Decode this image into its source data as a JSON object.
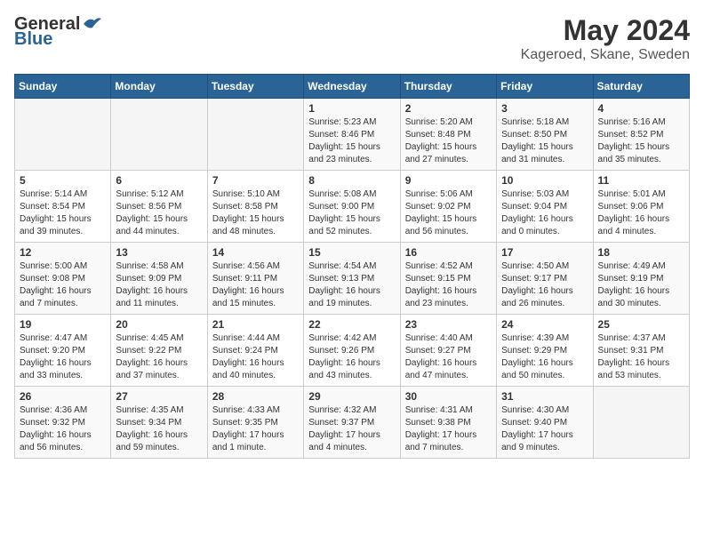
{
  "header": {
    "logo_general": "General",
    "logo_blue": "Blue",
    "month_year": "May 2024",
    "location": "Kageroed, Skane, Sweden"
  },
  "days_of_week": [
    "Sunday",
    "Monday",
    "Tuesday",
    "Wednesday",
    "Thursday",
    "Friday",
    "Saturday"
  ],
  "weeks": [
    [
      {
        "day": "",
        "info": ""
      },
      {
        "day": "",
        "info": ""
      },
      {
        "day": "",
        "info": ""
      },
      {
        "day": "1",
        "info": "Sunrise: 5:23 AM\nSunset: 8:46 PM\nDaylight: 15 hours and 23 minutes."
      },
      {
        "day": "2",
        "info": "Sunrise: 5:20 AM\nSunset: 8:48 PM\nDaylight: 15 hours and 27 minutes."
      },
      {
        "day": "3",
        "info": "Sunrise: 5:18 AM\nSunset: 8:50 PM\nDaylight: 15 hours and 31 minutes."
      },
      {
        "day": "4",
        "info": "Sunrise: 5:16 AM\nSunset: 8:52 PM\nDaylight: 15 hours and 35 minutes."
      }
    ],
    [
      {
        "day": "5",
        "info": "Sunrise: 5:14 AM\nSunset: 8:54 PM\nDaylight: 15 hours and 39 minutes."
      },
      {
        "day": "6",
        "info": "Sunrise: 5:12 AM\nSunset: 8:56 PM\nDaylight: 15 hours and 44 minutes."
      },
      {
        "day": "7",
        "info": "Sunrise: 5:10 AM\nSunset: 8:58 PM\nDaylight: 15 hours and 48 minutes."
      },
      {
        "day": "8",
        "info": "Sunrise: 5:08 AM\nSunset: 9:00 PM\nDaylight: 15 hours and 52 minutes."
      },
      {
        "day": "9",
        "info": "Sunrise: 5:06 AM\nSunset: 9:02 PM\nDaylight: 15 hours and 56 minutes."
      },
      {
        "day": "10",
        "info": "Sunrise: 5:03 AM\nSunset: 9:04 PM\nDaylight: 16 hours and 0 minutes."
      },
      {
        "day": "11",
        "info": "Sunrise: 5:01 AM\nSunset: 9:06 PM\nDaylight: 16 hours and 4 minutes."
      }
    ],
    [
      {
        "day": "12",
        "info": "Sunrise: 5:00 AM\nSunset: 9:08 PM\nDaylight: 16 hours and 7 minutes."
      },
      {
        "day": "13",
        "info": "Sunrise: 4:58 AM\nSunset: 9:09 PM\nDaylight: 16 hours and 11 minutes."
      },
      {
        "day": "14",
        "info": "Sunrise: 4:56 AM\nSunset: 9:11 PM\nDaylight: 16 hours and 15 minutes."
      },
      {
        "day": "15",
        "info": "Sunrise: 4:54 AM\nSunset: 9:13 PM\nDaylight: 16 hours and 19 minutes."
      },
      {
        "day": "16",
        "info": "Sunrise: 4:52 AM\nSunset: 9:15 PM\nDaylight: 16 hours and 23 minutes."
      },
      {
        "day": "17",
        "info": "Sunrise: 4:50 AM\nSunset: 9:17 PM\nDaylight: 16 hours and 26 minutes."
      },
      {
        "day": "18",
        "info": "Sunrise: 4:49 AM\nSunset: 9:19 PM\nDaylight: 16 hours and 30 minutes."
      }
    ],
    [
      {
        "day": "19",
        "info": "Sunrise: 4:47 AM\nSunset: 9:20 PM\nDaylight: 16 hours and 33 minutes."
      },
      {
        "day": "20",
        "info": "Sunrise: 4:45 AM\nSunset: 9:22 PM\nDaylight: 16 hours and 37 minutes."
      },
      {
        "day": "21",
        "info": "Sunrise: 4:44 AM\nSunset: 9:24 PM\nDaylight: 16 hours and 40 minutes."
      },
      {
        "day": "22",
        "info": "Sunrise: 4:42 AM\nSunset: 9:26 PM\nDaylight: 16 hours and 43 minutes."
      },
      {
        "day": "23",
        "info": "Sunrise: 4:40 AM\nSunset: 9:27 PM\nDaylight: 16 hours and 47 minutes."
      },
      {
        "day": "24",
        "info": "Sunrise: 4:39 AM\nSunset: 9:29 PM\nDaylight: 16 hours and 50 minutes."
      },
      {
        "day": "25",
        "info": "Sunrise: 4:37 AM\nSunset: 9:31 PM\nDaylight: 16 hours and 53 minutes."
      }
    ],
    [
      {
        "day": "26",
        "info": "Sunrise: 4:36 AM\nSunset: 9:32 PM\nDaylight: 16 hours and 56 minutes."
      },
      {
        "day": "27",
        "info": "Sunrise: 4:35 AM\nSunset: 9:34 PM\nDaylight: 16 hours and 59 minutes."
      },
      {
        "day": "28",
        "info": "Sunrise: 4:33 AM\nSunset: 9:35 PM\nDaylight: 17 hours and 1 minute."
      },
      {
        "day": "29",
        "info": "Sunrise: 4:32 AM\nSunset: 9:37 PM\nDaylight: 17 hours and 4 minutes."
      },
      {
        "day": "30",
        "info": "Sunrise: 4:31 AM\nSunset: 9:38 PM\nDaylight: 17 hours and 7 minutes."
      },
      {
        "day": "31",
        "info": "Sunrise: 4:30 AM\nSunset: 9:40 PM\nDaylight: 17 hours and 9 minutes."
      },
      {
        "day": "",
        "info": ""
      }
    ]
  ]
}
